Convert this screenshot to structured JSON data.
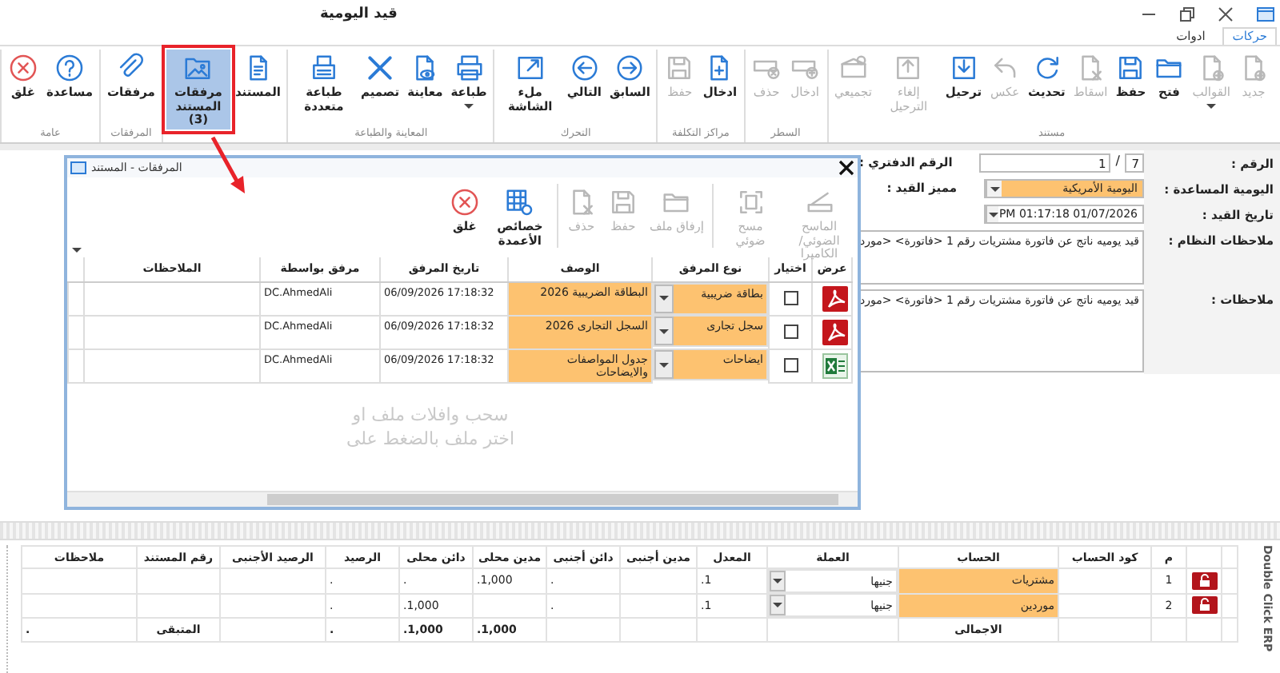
{
  "window": {
    "title": "قيد اليومية"
  },
  "tabs": [
    {
      "label": "حركات",
      "selected": true
    },
    {
      "label": "ادوات",
      "selected": false
    }
  ],
  "ribbon": {
    "groups": [
      {
        "label": "مستند",
        "buttons": [
          {
            "label": "جديد",
            "disabled": true,
            "active": false,
            "menu": false
          },
          {
            "label": "القوالب",
            "disabled": true,
            "active": false,
            "menu": true
          },
          {
            "label": "فتح",
            "disabled": false,
            "active": false,
            "menu": false
          },
          {
            "label": "حفظ",
            "disabled": false,
            "active": false,
            "menu": false
          },
          {
            "label": "اسقاط",
            "disabled": true,
            "active": false,
            "menu": false
          },
          {
            "label": "تحديث",
            "disabled": false,
            "active": false,
            "menu": false
          },
          {
            "label": "عكس",
            "disabled": true,
            "active": false,
            "menu": false
          },
          {
            "label": "ترحيل",
            "disabled": false,
            "active": false,
            "menu": false
          },
          {
            "label": "إلغاء الترحيل",
            "disabled": true,
            "active": false,
            "menu": false
          },
          {
            "label": "تجميعي",
            "disabled": true,
            "active": false,
            "menu": false
          }
        ]
      },
      {
        "label": "السطر",
        "buttons": [
          {
            "label": "ادخال",
            "disabled": true,
            "active": false,
            "menu": false
          },
          {
            "label": "حذف",
            "disabled": true,
            "active": false,
            "menu": false
          }
        ]
      },
      {
        "label": "مراكز التكلفة",
        "buttons": [
          {
            "label": "ادخال",
            "disabled": false,
            "active": false,
            "menu": false
          },
          {
            "label": "حفظ",
            "disabled": true,
            "active": false,
            "menu": false
          }
        ]
      },
      {
        "label": "التحرك",
        "buttons": [
          {
            "label": "السابق",
            "disabled": false,
            "active": false,
            "menu": false
          },
          {
            "label": "التالي",
            "disabled": false,
            "active": false,
            "menu": false
          },
          {
            "label": "ملء الشاشة",
            "disabled": false,
            "active": false,
            "menu": false
          }
        ]
      },
      {
        "label": "المعاينة والطباعة",
        "buttons": [
          {
            "label": "طباعة",
            "disabled": false,
            "active": false,
            "menu": true
          },
          {
            "label": "معاينة",
            "disabled": false,
            "active": false,
            "menu": false
          },
          {
            "label": "تصميم",
            "disabled": false,
            "active": false,
            "menu": false
          },
          {
            "label": "طباعة متعددة",
            "disabled": false,
            "active": false,
            "menu": false
          }
        ]
      },
      {
        "buttons": [
          {
            "label": "المستند",
            "disabled": false,
            "active": false,
            "menu": false
          },
          {
            "label": "مرفقات المستند (3)",
            "disabled": false,
            "active": true,
            "menu": false
          }
        ]
      },
      {
        "label": "المرفقات",
        "buttons": [
          {
            "label": "مرفقات",
            "disabled": false,
            "active": false,
            "menu": false
          }
        ]
      },
      {
        "label": "عامة",
        "buttons": [
          {
            "label": "مساعدة",
            "disabled": false,
            "active": false,
            "menu": false
          },
          {
            "label": "غلق",
            "disabled": false,
            "active": false,
            "menu": false
          }
        ]
      }
    ]
  },
  "annotation": {
    "kind": "frame-arrow"
  },
  "form": {
    "number_label": "الرقم :",
    "number": "7",
    "separator": "/",
    "number_2": "1",
    "book_number_label": "الرقم الدفتري :",
    "journal_label": "اليومية المساعدة :",
    "journal": "اليومية الأمريكية",
    "entry_mark_label": "مميز القيد :",
    "date_label": "تاريخ القيد :",
    "date": "01/07/2026 01:17:18 PM",
    "system_notes_label": "ملاحظات النظام :",
    "system_notes": "قيد يوميه ناتج عن فاتورة مشتريات رقم 1 <فاتورة> <مورد",
    "notes_label": "ملاحظات :",
    "notes": "قيد يوميه ناتج عن فاتورة مشتريات رقم 1 <فاتورة> <مورد"
  },
  "dialog": {
    "title": "المرفقات - المستند",
    "toolbar": [
      {
        "label": "الماسح الضوئي/الكاميرا",
        "disabled": true
      },
      {
        "label": "مسح ضوئي",
        "disabled": true
      },
      {
        "label": "إرفاق ملف",
        "disabled": true
      },
      {
        "label": "حفظ",
        "disabled": true
      },
      {
        "label": "حذف",
        "disabled": true
      },
      {
        "label": "خصائص الأعمدة",
        "disabled": false
      },
      {
        "label": "غلق",
        "disabled": false
      }
    ],
    "columns": [
      "عرض",
      "اختيار",
      "نوع المرفق",
      "الوصف",
      "تاريخ المرفق",
      "مرفق بواسطة",
      "الملاحظات"
    ],
    "rows": [
      {
        "kind": "pdf",
        "checked": false,
        "type": "بطاقة ضريبية",
        "description": "البطاقة الضريبية 2026",
        "date": "06/09/2026 17:18:32",
        "by": "DC.AhmedAli"
      },
      {
        "kind": "pdf",
        "checked": false,
        "type": "سجل تجارى",
        "description": "السجل التجارى 2026",
        "date": "06/09/2026 17:18:32",
        "by": "DC.AhmedAli"
      },
      {
        "kind": "sheet",
        "checked": false,
        "type": "ايضاحات",
        "description": "جدول المواصفات والايضاحات",
        "date": "06/09/2026 17:18:32",
        "by": "DC.AhmedAli"
      }
    ],
    "drop_hint": [
      "سحب وافلات ملف او",
      "اختر ملف بالضغط على"
    ]
  },
  "entries": {
    "columns": [
      "م",
      "كود الحساب",
      "الحساب",
      "العملة",
      "المعدل",
      "مدين أجنبى",
      "دائن أجنبى",
      "مدين محلى",
      "دائن محلى",
      "الرصيد",
      "الرصيد الأجنبى",
      "رقم المستند",
      "ملاحظات"
    ],
    "rows": [
      {
        "no": "1",
        "account": "مشتريات",
        "currency": "جنيها",
        "rate": "1.",
        "foreign_credit": ".",
        "local_debit": "1,000.",
        "local_credit": ".",
        "balance": "."
      },
      {
        "no": "2",
        "account": "موردين",
        "currency": "جنيها",
        "rate": "1.",
        "foreign_credit": ".",
        "local_credit": "1,000.",
        "balance": "."
      }
    ],
    "total": {
      "label": "الاجمالى",
      "local_debit": "1,000.",
      "local_credit": "1,000.",
      "balance": ".",
      "remaining_label": "المتبقى",
      "remaining": "."
    }
  },
  "side_label": "Double Click ERP"
}
